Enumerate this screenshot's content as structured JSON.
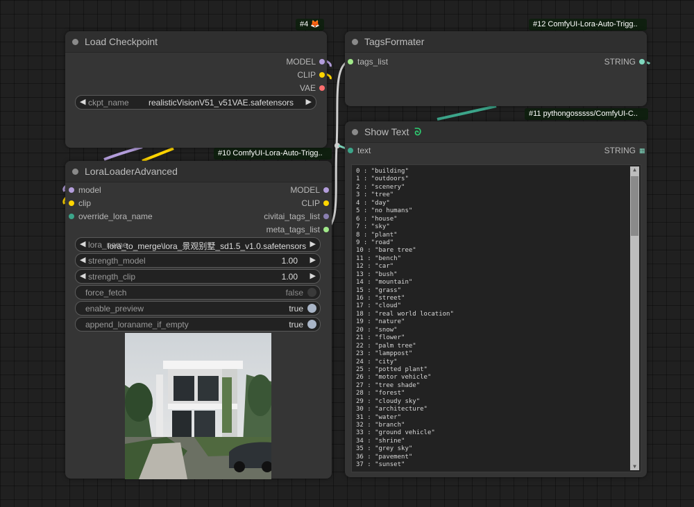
{
  "nodes": {
    "load_checkpoint": {
      "id_badge": "#4 🦊",
      "title": "Load Checkpoint",
      "outputs": [
        "MODEL",
        "CLIP",
        "VAE"
      ],
      "ckpt_label": "ckpt_name",
      "ckpt_value": "realisticVisionV51_v51VAE.safetensors"
    },
    "tags_formater": {
      "id_badge": "#12 ComfyUI-Lora-Auto-Trigg..",
      "title": "TagsFormater",
      "input": "tags_list",
      "output": "STRING"
    },
    "lora_loader": {
      "id_badge": "#10 ComfyUI-Lora-Auto-Trigg..",
      "title": "LoraLoaderAdvanced",
      "inputs": [
        "model",
        "clip",
        "override_lora_name"
      ],
      "outputs": [
        "MODEL",
        "CLIP",
        "civitai_tags_list",
        "meta_tags_list"
      ],
      "lora_label": "lora_name",
      "lora_value": "lora_to_merge\\lora_景观别墅_sd1.5_v1.0.safetensors",
      "strength_model_label": "strength_model",
      "strength_model_value": "1.00",
      "strength_clip_label": "strength_clip",
      "strength_clip_value": "1.00",
      "force_fetch_label": "force_fetch",
      "force_fetch_value": "false",
      "enable_preview_label": "enable_preview",
      "enable_preview_value": "true",
      "append_label": "append_loraname_if_empty",
      "append_value": "true"
    },
    "show_text": {
      "id_badge": "#11 pythongosssss/ComfyUI-C..",
      "title": "Show Text",
      "input": "text",
      "output": "STRING",
      "lines": [
        "0 : \"building\"",
        "1 : \"outdoors\"",
        "2 : \"scenery\"",
        "3 : \"tree\"",
        "4 : \"day\"",
        "5 : \"no humans\"",
        "6 : \"house\"",
        "7 : \"sky\"",
        "8 : \"plant\"",
        "9 : \"road\"",
        "10 : \"bare tree\"",
        "11 : \"bench\"",
        "12 : \"car\"",
        "13 : \"bush\"",
        "14 : \"mountain\"",
        "15 : \"grass\"",
        "16 : \"street\"",
        "17 : \"cloud\"",
        "18 : \"real world location\"",
        "19 : \"nature\"",
        "20 : \"snow\"",
        "21 : \"flower\"",
        "22 : \"palm tree\"",
        "23 : \"lamppost\"",
        "24 : \"city\"",
        "25 : \"potted plant\"",
        "26 : \"motor vehicle\"",
        "27 : \"tree shade\"",
        "28 : \"forest\"",
        "29 : \"cloudy sky\"",
        "30 : \"architecture\"",
        "31 : \"water\"",
        "32 : \"branch\"",
        "33 : \"ground vehicle\"",
        "34 : \"shrine\"",
        "35 : \"grey sky\"",
        "36 : \"pavement\"",
        "37 : \"sunset\""
      ]
    }
  },
  "colors": {
    "model": "#b39ddb",
    "clip": "#ffd500",
    "vae": "#ff6e6e",
    "string": "#7fd8be",
    "list": "#a1e98a",
    "canvas": "#202020",
    "node": "#353535"
  }
}
